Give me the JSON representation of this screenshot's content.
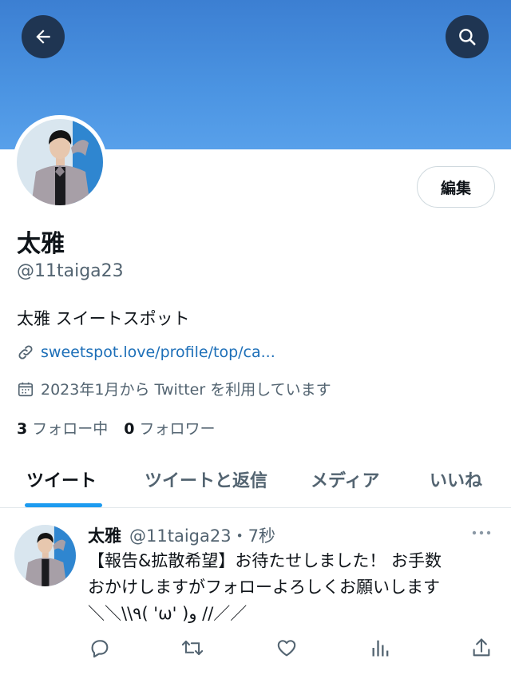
{
  "header": {
    "back_icon": "arrow-left-icon",
    "search_icon": "search-icon",
    "banner_color": "#4b94e2"
  },
  "profile": {
    "name": "太雅",
    "handle": "@11taiga23",
    "bio": "太雅 スイートスポット",
    "link": "sweetspot.love/profile/top/ca...",
    "joined": "2023年1月から Twitter を利用しています",
    "edit_label": "編集",
    "following_count": "3",
    "following_label": "フォロー中",
    "followers_count": "0",
    "followers_label": "フォロワー"
  },
  "tabs": [
    {
      "label": "ツイート",
      "active": true
    },
    {
      "label": "ツイートと返信",
      "active": false
    },
    {
      "label": "メディア",
      "active": false
    },
    {
      "label": "いいね",
      "active": false
    }
  ],
  "tweet": {
    "name": "太雅",
    "meta": "@11taiga23・7秒",
    "text_lines": [
      "【報告&拡散希望】お待たせしました！ お手数",
      "おかけしますがフォローよろしくお願いします",
      "＼＼\\\\٩( 'ω' )و //／／"
    ],
    "action_icons": [
      "reply-icon",
      "retweet-icon",
      "like-icon",
      "views-icon",
      "share-icon"
    ]
  },
  "colors": {
    "accent": "#1d9bf0",
    "link": "#1d6fb8",
    "muted": "#536471"
  }
}
